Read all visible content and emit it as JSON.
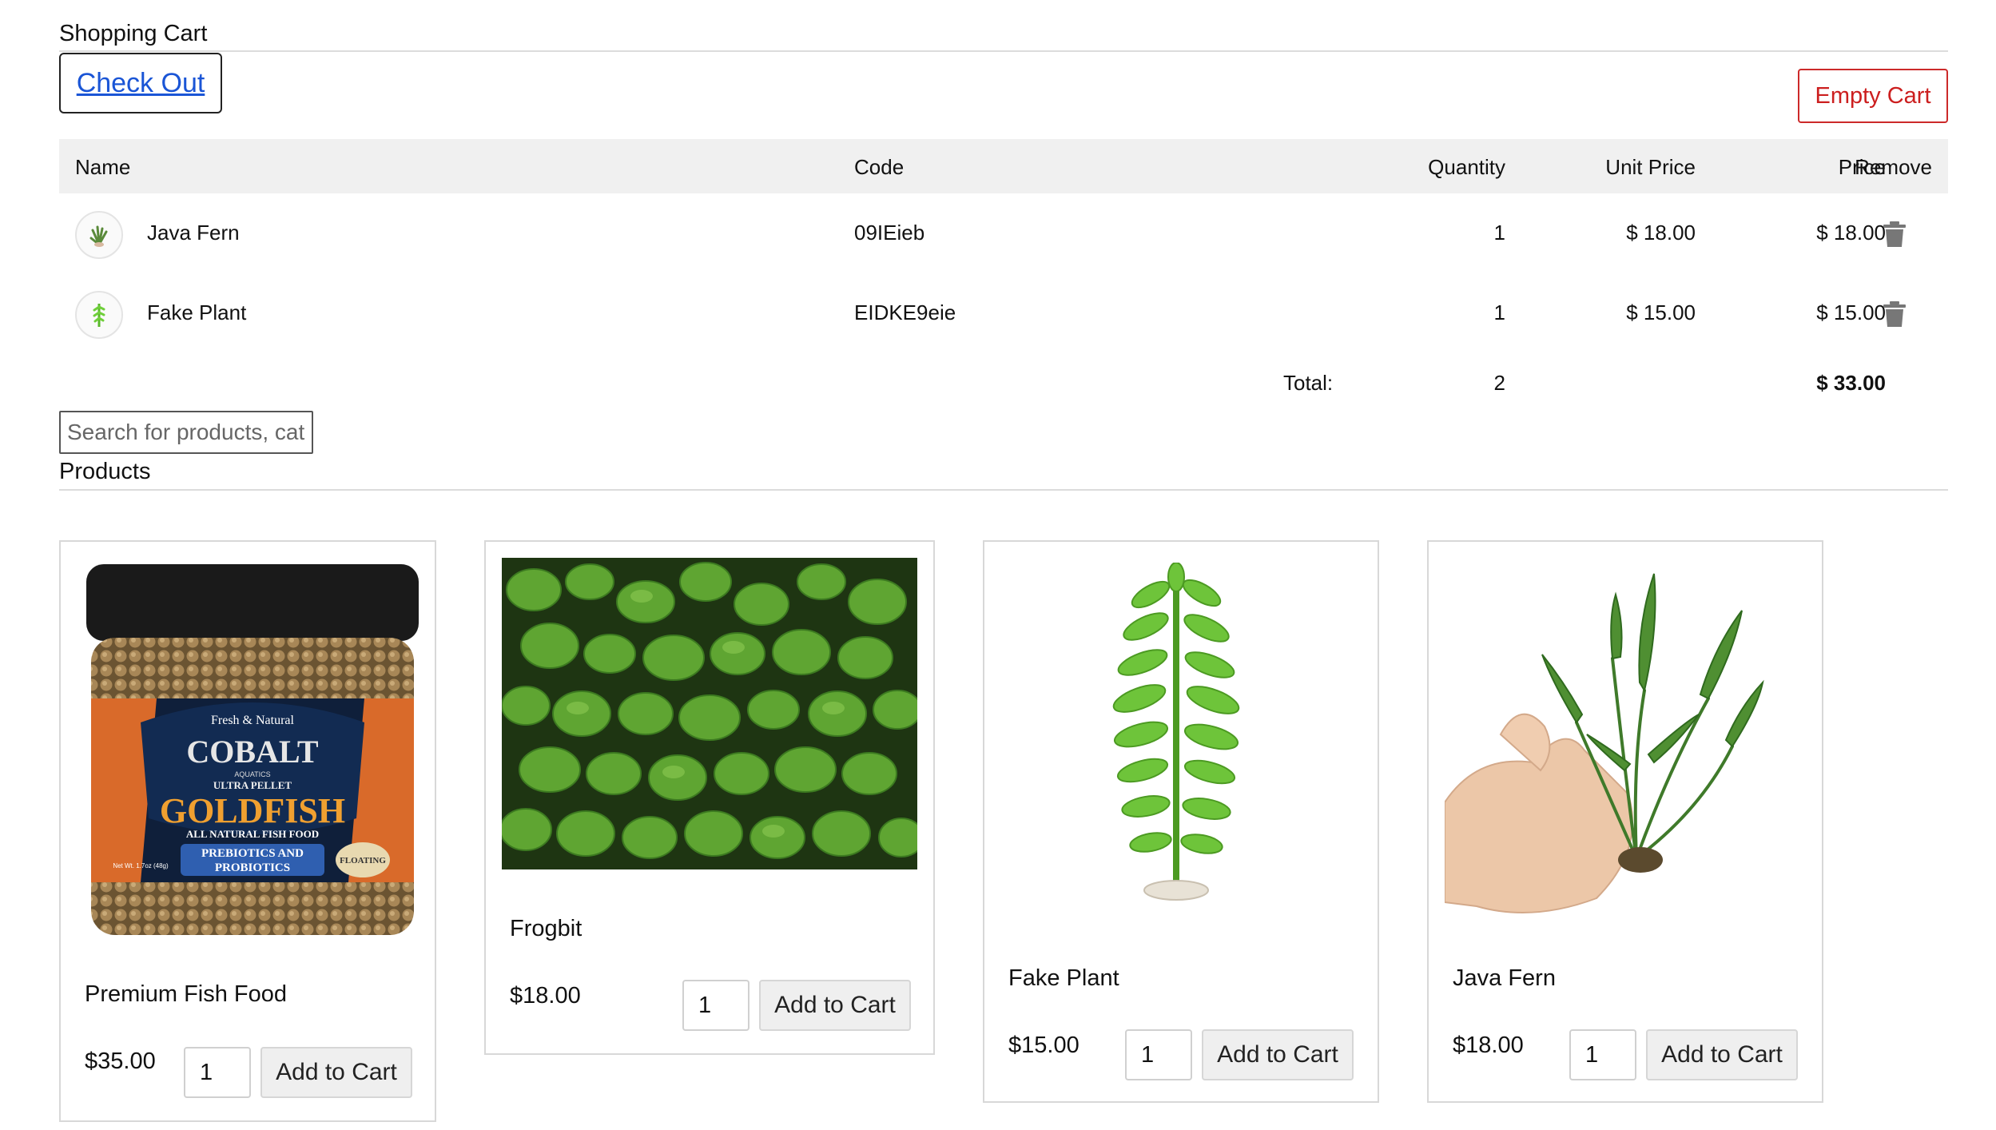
{
  "cart": {
    "title": "Shopping Cart",
    "checkout_label": "Check Out",
    "empty_label": "Empty Cart",
    "columns": {
      "name": "Name",
      "code": "Code",
      "quantity": "Quantity",
      "unit_price": "Unit Price",
      "price": "Price",
      "remove": "Remove"
    },
    "items": [
      {
        "name": "Java Fern",
        "code": "09IEieb",
        "quantity": "1",
        "unit_price": "$ 18.00",
        "price": "$ 18.00",
        "thumb_icon": "java-fern-thumbnail"
      },
      {
        "name": "Fake Plant",
        "code": "EIDKE9eie",
        "quantity": "1",
        "unit_price": "$ 15.00",
        "price": "$ 15.00",
        "thumb_icon": "fake-plant-thumbnail"
      }
    ],
    "total_label": "Total:",
    "total_quantity": "2",
    "total_price": "$ 33.00",
    "remove_icon": "trash-icon"
  },
  "search": {
    "placeholder": "Search for products, categories"
  },
  "products": {
    "title": "Products",
    "items": [
      {
        "name": "Premium Fish Food",
        "price": "$35.00",
        "quantity": "1",
        "add_label": "Add to Cart",
        "image_icon": "fish-food-jar-image",
        "image_text": [
          "Fresh & Natural",
          "COBALT",
          "AQUATICS",
          "ULTRA PELLET",
          "GOLDFISH",
          "ALL NATURAL FISH FOOD",
          "PREBIOTICS AND",
          "PROBIOTICS",
          "FLOATING",
          "Net Wt. 1.7oz (48g)"
        ]
      },
      {
        "name": "Frogbit",
        "price": "$18.00",
        "quantity": "1",
        "add_label": "Add to Cart",
        "image_icon": "frogbit-plants-image"
      },
      {
        "name": "Fake Plant",
        "price": "$15.00",
        "quantity": "1",
        "add_label": "Add to Cart",
        "image_icon": "fake-plant-image"
      },
      {
        "name": "Java Fern",
        "price": "$18.00",
        "quantity": "1",
        "add_label": "Add to Cart",
        "image_icon": "java-fern-in-hand-image"
      }
    ]
  },
  "colors": {
    "link": "#1a55d6",
    "danger": "#cc1f1f",
    "header_bg": "#f0f0f0",
    "button_bg": "#efefef"
  }
}
